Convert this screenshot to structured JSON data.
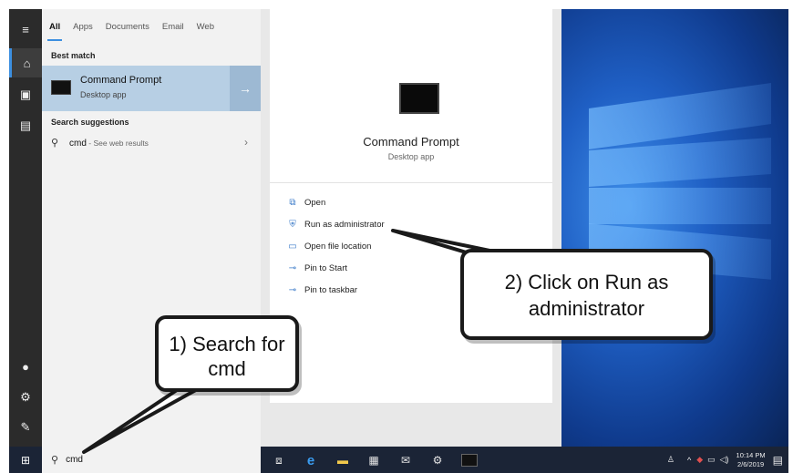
{
  "start_menu": {
    "tabs": [
      {
        "label": "All",
        "active": true
      },
      {
        "label": "Apps"
      },
      {
        "label": "Documents"
      },
      {
        "label": "Email"
      },
      {
        "label": "Web"
      }
    ],
    "best_match_heading": "Best match",
    "best_match": {
      "title": "Command Prompt",
      "subtitle": "Desktop app",
      "icon": "terminal-icon"
    },
    "suggestions_heading": "Search suggestions",
    "suggestion": {
      "query": "cmd",
      "suffix": " - See web results"
    }
  },
  "detail": {
    "title": "Command Prompt",
    "subtitle": "Desktop app",
    "actions": [
      {
        "label": "Open",
        "icon": "open-icon"
      },
      {
        "label": "Run as administrator",
        "icon": "shield-icon"
      },
      {
        "label": "Open file location",
        "icon": "folder-icon"
      },
      {
        "label": "Pin to Start",
        "icon": "pin-icon"
      },
      {
        "label": "Pin to taskbar",
        "icon": "pin-icon"
      }
    ]
  },
  "taskbar": {
    "search_value": "cmd",
    "clock_time": "10:14 PM",
    "clock_date": "2/6/2019"
  },
  "callouts": {
    "step1": "1) Search for cmd",
    "step2": "2) Click on Run as administrator"
  },
  "colors": {
    "accent": "#3c8fe0",
    "best_match_bg": "#b7cfe4",
    "taskbar": "#1b2436"
  }
}
